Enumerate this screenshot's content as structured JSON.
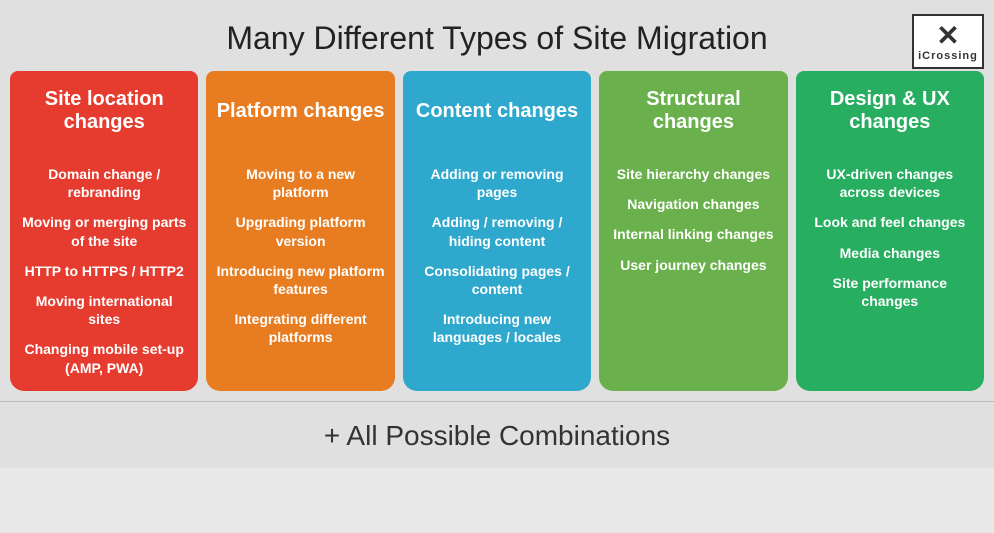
{
  "header": {
    "title": "Many Different Types of Site Migration",
    "logo_x": "✕",
    "logo_brand": "iCrossing"
  },
  "columns": [
    {
      "id": "site-location",
      "header": "Site location changes",
      "header_color": "red-header",
      "body_color": "red-body",
      "items": [
        "Domain change / rebranding",
        "Moving or merging parts of the site",
        "HTTP to HTTPS / HTTP2",
        "Moving international sites",
        "Changing mobile set-up (AMP, PWA)"
      ]
    },
    {
      "id": "platform",
      "header": "Platform changes",
      "header_color": "orange-header",
      "body_color": "orange-body",
      "items": [
        "Moving to a new platform",
        "Upgrading platform version",
        "Introducing new platform features",
        "Integrating different platforms"
      ]
    },
    {
      "id": "content",
      "header": "Content changes",
      "header_color": "blue-header",
      "body_color": "blue-body",
      "items": [
        "Adding or removing pages",
        "Adding  / removing / hiding content",
        "Consolidating pages / content",
        "Introducing new languages / locales"
      ]
    },
    {
      "id": "structural",
      "header": "Structural changes",
      "header_color": "green-header",
      "body_color": "green-body",
      "items": [
        "Site hierarchy changes",
        "Navigation changes",
        "Internal linking changes",
        "User journey changes"
      ]
    },
    {
      "id": "design-ux",
      "header": "Design & UX changes",
      "header_color": "dkgreen-header",
      "body_color": "dkgreen-body",
      "items": [
        "UX-driven changes across devices",
        "Look and feel changes",
        "Media changes",
        "Site performance changes"
      ]
    }
  ],
  "footer": {
    "text": "+ All Possible Combinations"
  }
}
